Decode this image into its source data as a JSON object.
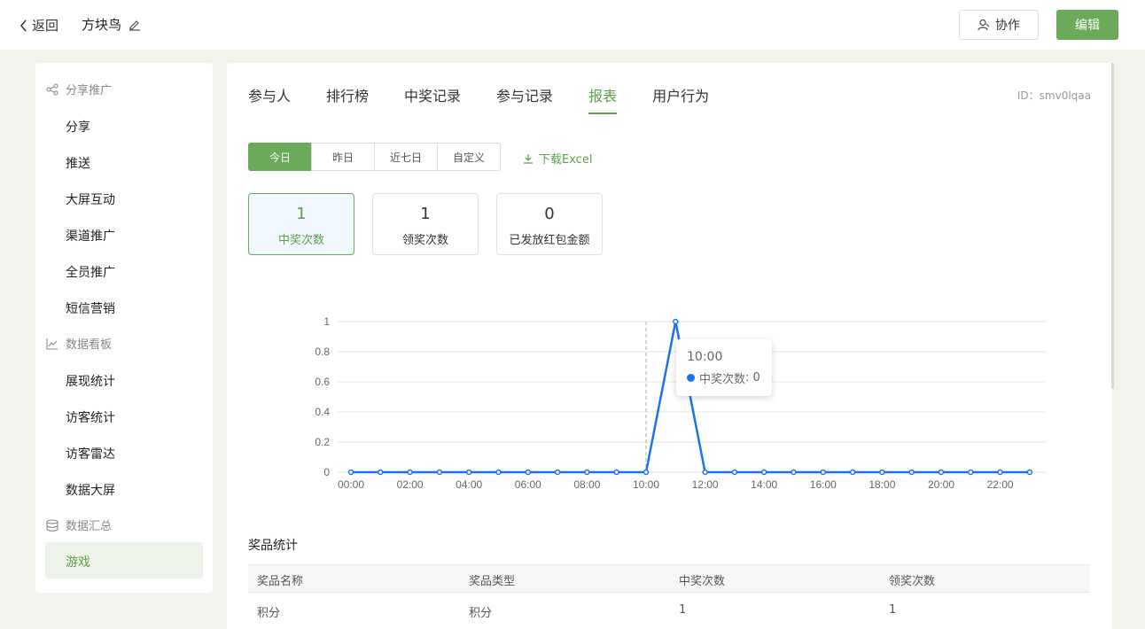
{
  "header": {
    "back_label": "返回",
    "app_name": "方块鸟",
    "collab_label": "协作",
    "edit_label": "编辑"
  },
  "sidebar": {
    "groups": [
      {
        "label": "分享推广",
        "icon": "share-icon",
        "items": [
          "分享",
          "推送",
          "大屏互动",
          "渠道推广",
          "全员推广",
          "短信营销"
        ]
      },
      {
        "label": "数据看板",
        "icon": "line-chart-icon",
        "items": [
          "展现统计",
          "访客统计",
          "访客雷达",
          "数据大屏"
        ]
      },
      {
        "label": "数据汇总",
        "icon": "database-icon",
        "items": [
          "游戏"
        ]
      }
    ],
    "active_item": "游戏"
  },
  "tabs": [
    "参与人",
    "排行榜",
    "中奖记录",
    "参与记录",
    "报表",
    "用户行为"
  ],
  "active_tab": "报表",
  "page_id": "ID：smv0lqaa",
  "date_filters": [
    "今日",
    "昨日",
    "近七日",
    "自定义"
  ],
  "active_filter": "今日",
  "download_label": "下载Excel",
  "stats": [
    {
      "value": "1",
      "label": "中奖次数"
    },
    {
      "value": "1",
      "label": "领奖次数"
    },
    {
      "value": "0",
      "label": "已发放红包金额"
    }
  ],
  "tooltip": {
    "time": "10:00",
    "series": "中奖次数",
    "value": "0"
  },
  "colors": {
    "accent": "#6aaa58",
    "line": "#1a73e8"
  },
  "prize_section": {
    "title": "奖品统计",
    "columns": [
      "奖品名称",
      "奖品类型",
      "中奖次数",
      "领奖次数"
    ],
    "rows": [
      [
        "积分",
        "积分",
        "1",
        "1"
      ]
    ]
  },
  "chart_data": {
    "type": "line",
    "x": [
      "00:00",
      "01:00",
      "02:00",
      "03:00",
      "04:00",
      "05:00",
      "06:00",
      "07:00",
      "08:00",
      "09:00",
      "10:00",
      "11:00",
      "12:00",
      "13:00",
      "14:00",
      "15:00",
      "16:00",
      "17:00",
      "18:00",
      "19:00",
      "20:00",
      "21:00",
      "22:00",
      "23:00"
    ],
    "x_tick_labels": [
      "00:00",
      "02:00",
      "04:00",
      "06:00",
      "08:00",
      "10:00",
      "12:00",
      "14:00",
      "16:00",
      "18:00",
      "20:00",
      "22:00"
    ],
    "series": [
      {
        "name": "中奖次数",
        "values": [
          0,
          0,
          0,
          0,
          0,
          0,
          0,
          0,
          0,
          0,
          0,
          1,
          0,
          0,
          0,
          0,
          0,
          0,
          0,
          0,
          0,
          0,
          0,
          0
        ]
      }
    ],
    "y_ticks": [
      "0",
      "0.2",
      "0.4",
      "0.6",
      "0.8",
      "1"
    ],
    "ylim": [
      0,
      1
    ],
    "grid": true,
    "title": "",
    "xlabel": "",
    "ylabel": ""
  }
}
